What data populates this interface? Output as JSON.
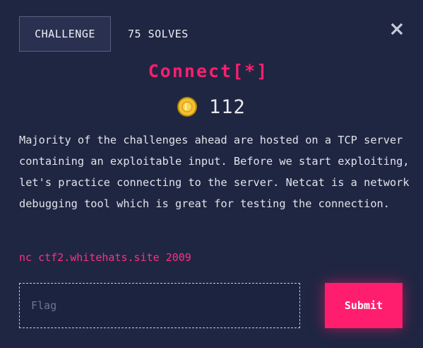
{
  "header": {
    "tab_challenge": "CHALLENGE",
    "tab_solves": "75 SOLVES",
    "close_icon": "close-icon"
  },
  "challenge": {
    "title": "Connect[*]",
    "points": "112",
    "points_icon": "coin-icon",
    "description": "Majority of the challenges ahead are hosted on a TCP server containing an exploitable input. Before we start exploiting, let's practice connecting to the server. Netcat is a network debugging tool which is great for testing the connection.",
    "connection_command": "nc ctf2.whitehats.site 2009"
  },
  "form": {
    "flag_placeholder": "Flag",
    "flag_value": "",
    "submit_label": "Submit"
  },
  "colors": {
    "background": "#1f2642",
    "accent": "#ff1e6e",
    "coin": "#f2c230"
  }
}
